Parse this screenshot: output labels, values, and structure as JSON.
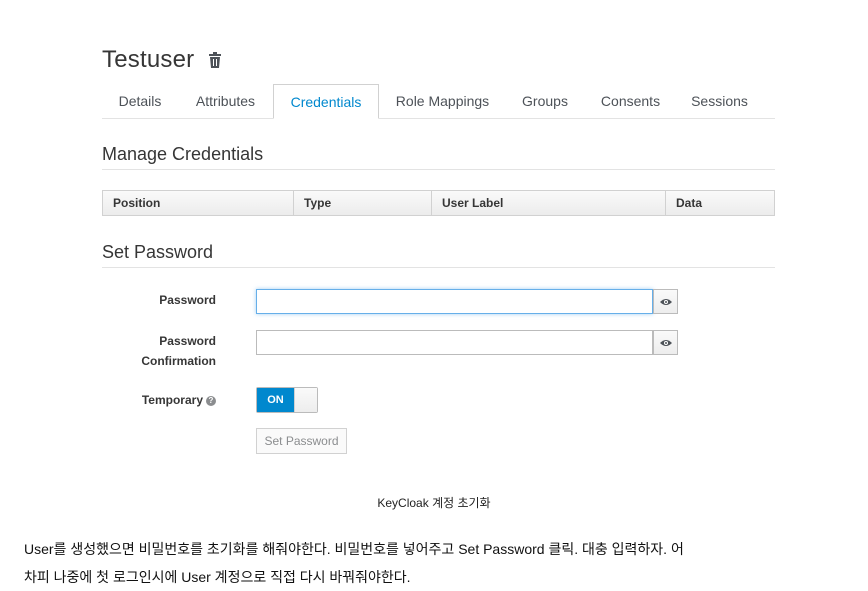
{
  "user": {
    "name": "Testuser",
    "delete_icon": "trash-icon"
  },
  "tabs": [
    {
      "label": "Details"
    },
    {
      "label": "Attributes"
    },
    {
      "label": "Credentials"
    },
    {
      "label": "Role Mappings"
    },
    {
      "label": "Groups"
    },
    {
      "label": "Consents"
    },
    {
      "label": "Sessions"
    }
  ],
  "active_tab": "Credentials",
  "manage_credentials": {
    "title": "Manage Credentials",
    "columns": [
      "Position",
      "Type",
      "User Label",
      "Data"
    ]
  },
  "set_password": {
    "title": "Set Password",
    "password_label": "Password",
    "password_value": "",
    "confirmation_label_line1": "Password",
    "confirmation_label_line2": "Confirmation",
    "confirmation_value": "",
    "show_icon": "eye-icon",
    "temporary_label": "Temporary",
    "temporary_help_icon": "question-circle-icon",
    "temporary_state": "ON",
    "submit_label": "Set Password"
  },
  "caption": "KeyCloak 계정 초기화",
  "body_text_line1": "User를 생성했으면 비밀번호를 초기화를 해줘야한다. 비밀번호를 넣어주고 Set Password 클릭. 대충 입력하자. 어",
  "body_text_line2": "차피 나중에 첫 로그인시에 User 계정으로 직접 다시 바꿔줘야한다.",
  "colors": {
    "accent": "#0088ce",
    "text": "#363636",
    "border": "#d1d1d1"
  }
}
